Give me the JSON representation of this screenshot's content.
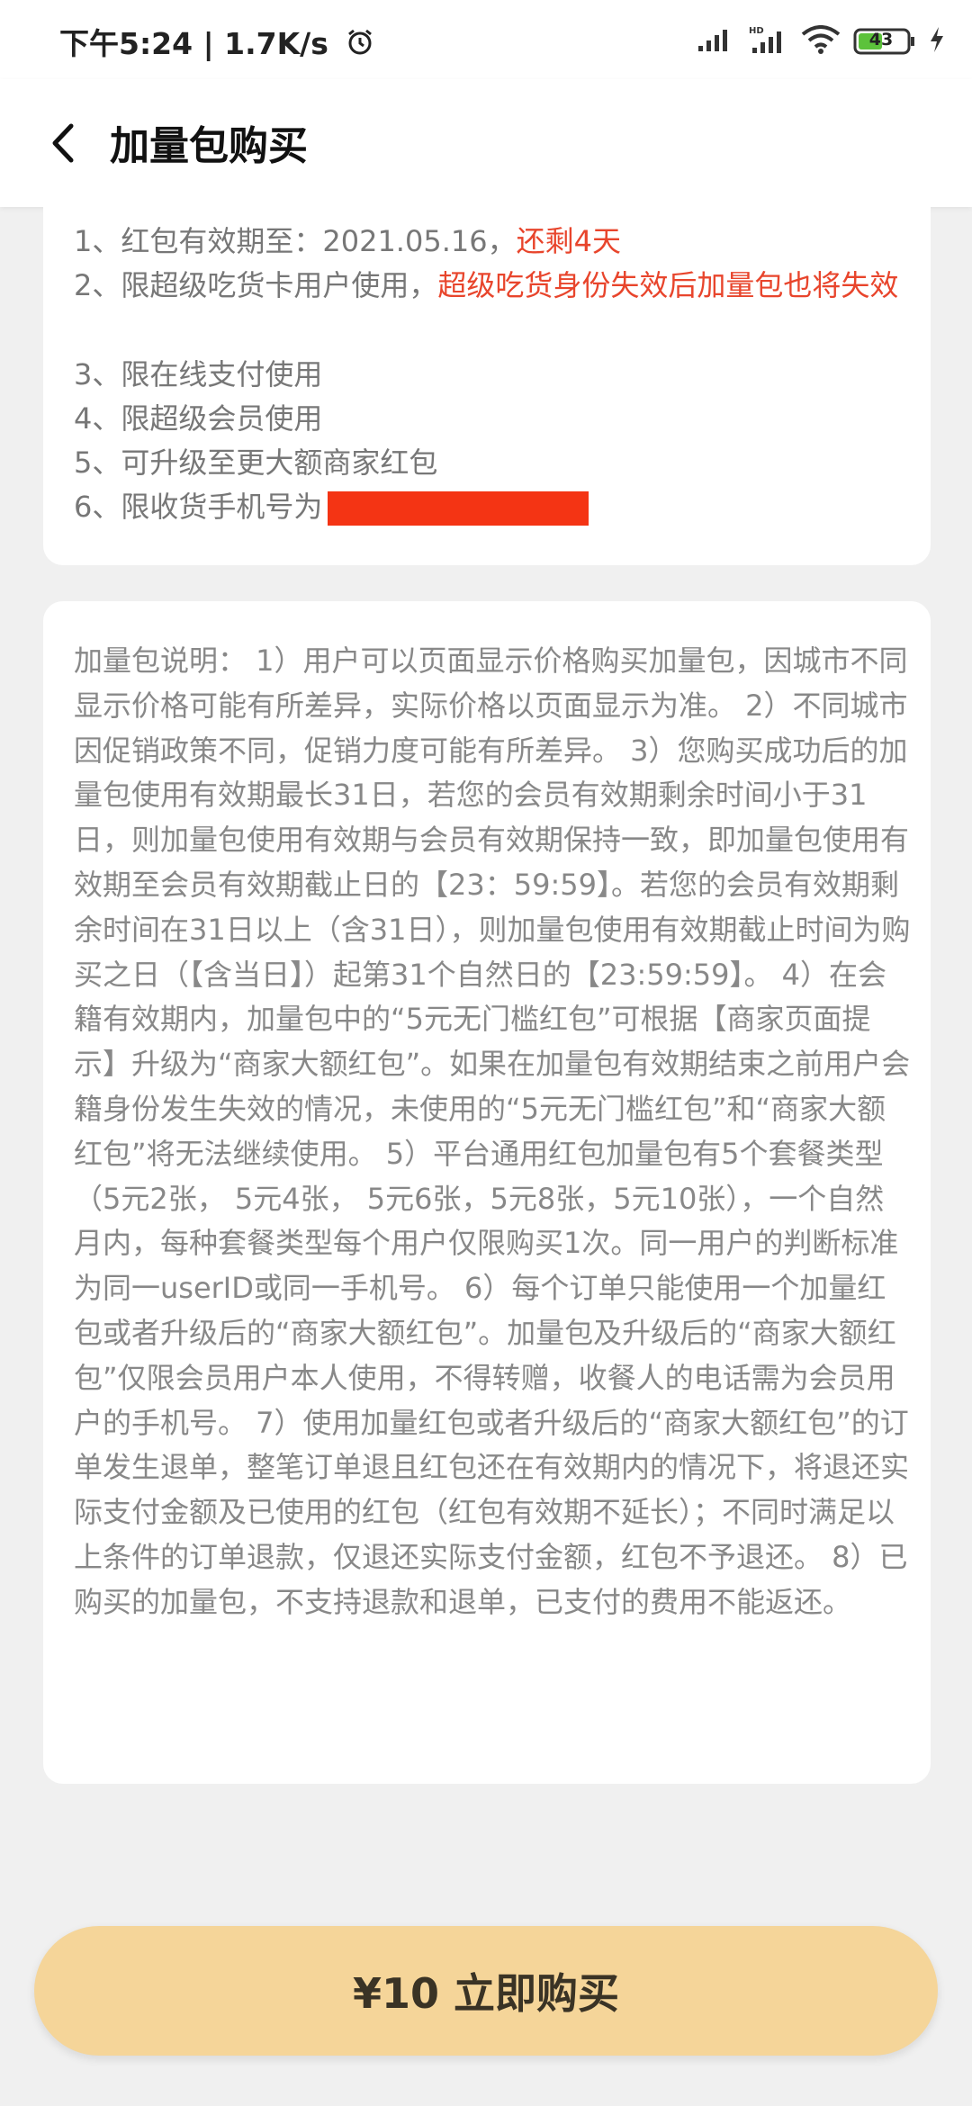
{
  "status_bar": {
    "time": "下午5:24 | 1.7K/s",
    "battery": "43",
    "icons": [
      "alarm-icon",
      "signal-icon",
      "hd-signal-icon",
      "wifi-icon",
      "battery-icon",
      "charging-icon"
    ]
  },
  "header": {
    "title": "加量包购买",
    "back_icon": "chevron-left-icon"
  },
  "rules": {
    "r1_prefix": "1、红包有效期至：2021.05.16，",
    "r1_red": "还剩4天",
    "r2_prefix": "2、限超级吃货卡用户使用，",
    "r2_red": "超级吃货身份失效后加量包也将失效",
    "r3": "3、限在线支付使用",
    "r4": "4、限超级会员使用",
    "r5": "5、可升级至更大额商家红包",
    "r6": "6、限收货手机号为"
  },
  "description": "加量包说明： 1）用户可以页面显示价格购买加量包，因城市不同显示价格可能有所差异，实际价格以页面显示为准。 2）不同城市因促销政策不同，促销力度可能有所差异。 3）您购买成功后的加量包使用有效期最长31日，若您的会员有效期剩余时间小于31日，则加量包使用有效期与会员有效期保持一致，即加量包使用有效期至会员有效期截止日的【23：59:59】。若您的会员有效期剩余时间在31日以上（含31日），则加量包使用有效期截止时间为购买之日（【含当日】）起第31个自然日的【23:59:59】。 4）在会籍有效期内，加量包中的“5元无门槛红包”可根据【商家页面提示】升级为“商家大额红包”。如果在加量包有效期结束之前用户会籍身份发生失效的情况，未使用的“5元无门槛红包”和“商家大额红包”将无法继续使用。 5）平台通用红包加量包有5个套餐类型（5元2张， 5元4张， 5元6张，5元8张，5元10张），一个自然月内，每种套餐类型每个用户仅限购买1次。同一用户的判断标准为同一userID或同一手机号。 6）每个订单只能使用一个加量红包或者升级后的“商家大额红包”。加量包及升级后的“商家大额红包”仅限会员用户本人使用，不得转赠，收餐人的电话需为会员用户的手机号。 7）使用加量红包或者升级后的“商家大额红包”的订单发生退单，整笔订单退且红包还在有效期内的情况下，将退还实际支付金额及已使用的红包（红包有效期不延长）；不同时满足以上条件的订单退款，仅退还实际支付金额，红包不予退还。 8）已购买的加量包，不支持退款和退单，已支付的费用不能返还。",
  "buy_button": {
    "label": "¥10 立即购买"
  },
  "colors": {
    "accent_red": "#e8452c",
    "button_bg": "#f5d599",
    "page_bg": "#f0f0f0"
  }
}
